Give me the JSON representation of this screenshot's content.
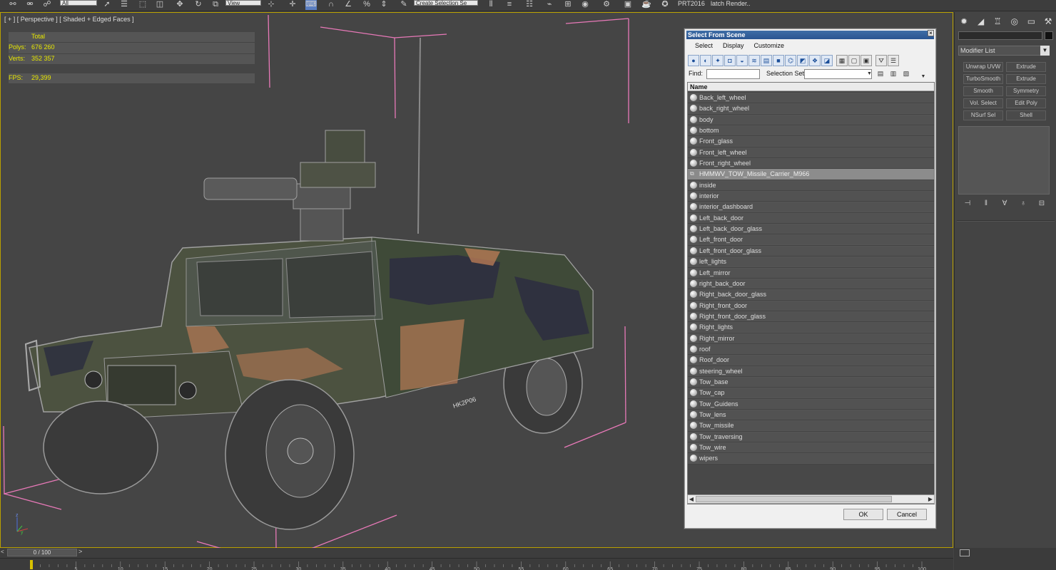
{
  "toolbar": {
    "selection_filter": "All",
    "ref_coord": "View",
    "selection_set_placeholder": "Create Selection Se",
    "layer_name": "PRT2016",
    "batch_render_label": "latch Render.."
  },
  "viewport": {
    "label": "[ + ] [ Perspective ] [ Shaded + Edged Faces ]",
    "stats": {
      "total_header": "Total",
      "polys_label": "Polys:",
      "polys_value": "676 260",
      "verts_label": "Verts:",
      "verts_value": "352 357",
      "fps_label": "FPS:",
      "fps_value": "29,399"
    },
    "vehicle_marking": "HK2P06"
  },
  "command_panel": {
    "modifier_list_label": "Modifier List",
    "modifier_buttons": [
      "Unwrap UVW",
      "Extrude",
      "TurboSmooth",
      "Extrude",
      "Smooth",
      "Symmetry",
      "Vol. Select",
      "Edit Poly",
      "NSurf Sel",
      "Shell"
    ]
  },
  "dialog": {
    "title": "Select From Scene",
    "menu": [
      "Select",
      "Display",
      "Customize"
    ],
    "find_label": "Find:",
    "selection_set_label": "Selection Set:",
    "column_header": "Name",
    "objects": [
      {
        "name": "Back_left_wheel",
        "selected": false,
        "group": false
      },
      {
        "name": "back_right_wheel",
        "selected": false,
        "group": false
      },
      {
        "name": "body",
        "selected": false,
        "group": false
      },
      {
        "name": "bottom",
        "selected": false,
        "group": false
      },
      {
        "name": "Front_glass",
        "selected": false,
        "group": false
      },
      {
        "name": "Front_left_wheel",
        "selected": false,
        "group": false
      },
      {
        "name": "Front_right_wheel",
        "selected": false,
        "group": false
      },
      {
        "name": "HMMWV_TOW_Missile_Carrier_M966",
        "selected": true,
        "group": true
      },
      {
        "name": "inside",
        "selected": false,
        "group": false
      },
      {
        "name": "interior",
        "selected": false,
        "group": false
      },
      {
        "name": "interior_dashboard",
        "selected": false,
        "group": false
      },
      {
        "name": "Left_back_door",
        "selected": false,
        "group": false
      },
      {
        "name": "Left_back_door_glass",
        "selected": false,
        "group": false
      },
      {
        "name": "Left_front_door",
        "selected": false,
        "group": false
      },
      {
        "name": "Left_front_door_glass",
        "selected": false,
        "group": false
      },
      {
        "name": "left_lights",
        "selected": false,
        "group": false
      },
      {
        "name": "Left_mirror",
        "selected": false,
        "group": false
      },
      {
        "name": "right_back_door",
        "selected": false,
        "group": false
      },
      {
        "name": "Right_back_door_glass",
        "selected": false,
        "group": false
      },
      {
        "name": "Right_front_door",
        "selected": false,
        "group": false
      },
      {
        "name": "Right_front_door_glass",
        "selected": false,
        "group": false
      },
      {
        "name": "Right_lights",
        "selected": false,
        "group": false
      },
      {
        "name": "Right_mirror",
        "selected": false,
        "group": false
      },
      {
        "name": "roof",
        "selected": false,
        "group": false
      },
      {
        "name": "Roof_door",
        "selected": false,
        "group": false
      },
      {
        "name": "steering_wheel",
        "selected": false,
        "group": false
      },
      {
        "name": "Tow_base",
        "selected": false,
        "group": false
      },
      {
        "name": "Tow_cap",
        "selected": false,
        "group": false
      },
      {
        "name": "Tow_Guidens",
        "selected": false,
        "group": false
      },
      {
        "name": "Tow_lens",
        "selected": false,
        "group": false
      },
      {
        "name": "Tow_missile",
        "selected": false,
        "group": false
      },
      {
        "name": "Tow_traversing",
        "selected": false,
        "group": false
      },
      {
        "name": "Tow_wire",
        "selected": false,
        "group": false
      },
      {
        "name": "wipers",
        "selected": false,
        "group": false
      }
    ],
    "ok_label": "OK",
    "cancel_label": "Cancel"
  },
  "timeline": {
    "frame_indicator": "0 / 100",
    "ticks": [
      "5",
      "10",
      "15",
      "20",
      "25",
      "30",
      "35",
      "40",
      "45",
      "50",
      "55",
      "60",
      "65",
      "70",
      "75",
      "80",
      "85",
      "90",
      "95",
      "100"
    ]
  },
  "colors": {
    "viewport_bg": "#454545",
    "active_border": "#b9a000",
    "stats_text": "#e8e800",
    "bbox_pink": "#e879b8",
    "dialog_title": "#2a5591"
  }
}
